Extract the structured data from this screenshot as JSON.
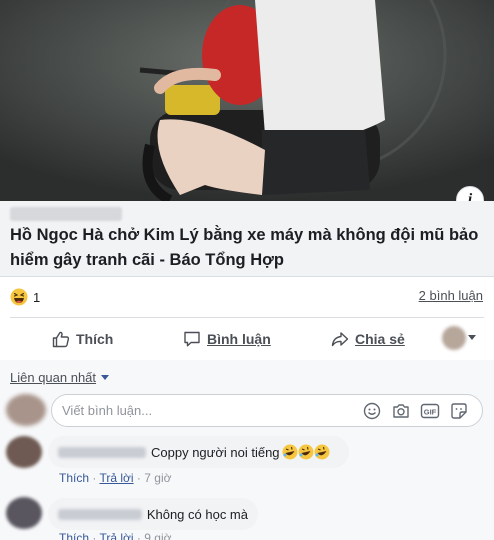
{
  "preview": {
    "title": "Hồ Ngọc Hà chở Kim Lý bằng xe máy mà không đội mũ bảo hiểm gây tranh cãi - Báo Tổng Hợp",
    "info_glyph": "i",
    "image_icon": "photo-motorbike-riders"
  },
  "reactions": {
    "icon": "haha-icon",
    "count": "1",
    "comments_link": "2 bình luận"
  },
  "actions": {
    "like": "Thích",
    "comment": "Bình luận",
    "share": "Chia sẻ"
  },
  "comments_section": {
    "sort_label": "Liên quan nhất",
    "input_placeholder": "Viết bình luận...",
    "input_icons": [
      "emoji-icon",
      "camera-icon",
      "gif-icon",
      "sticker-icon"
    ],
    "items": [
      {
        "text": "Coppy người noi tiếng",
        "emoji": [
          "rofl-icon",
          "rofl-icon",
          "rofl-icon"
        ],
        "like_label": "Thích",
        "reply_label": "Trả lời",
        "time": "7 giờ"
      },
      {
        "text": "Không có học mà",
        "emoji": [],
        "like_label": "Thích",
        "reply_label": "Trả lời",
        "time": "9 giờ"
      }
    ]
  },
  "colors": {
    "link_blue": "#385898",
    "text_gray": "#4b4f56",
    "caption_bg": "#f2f3f5"
  }
}
